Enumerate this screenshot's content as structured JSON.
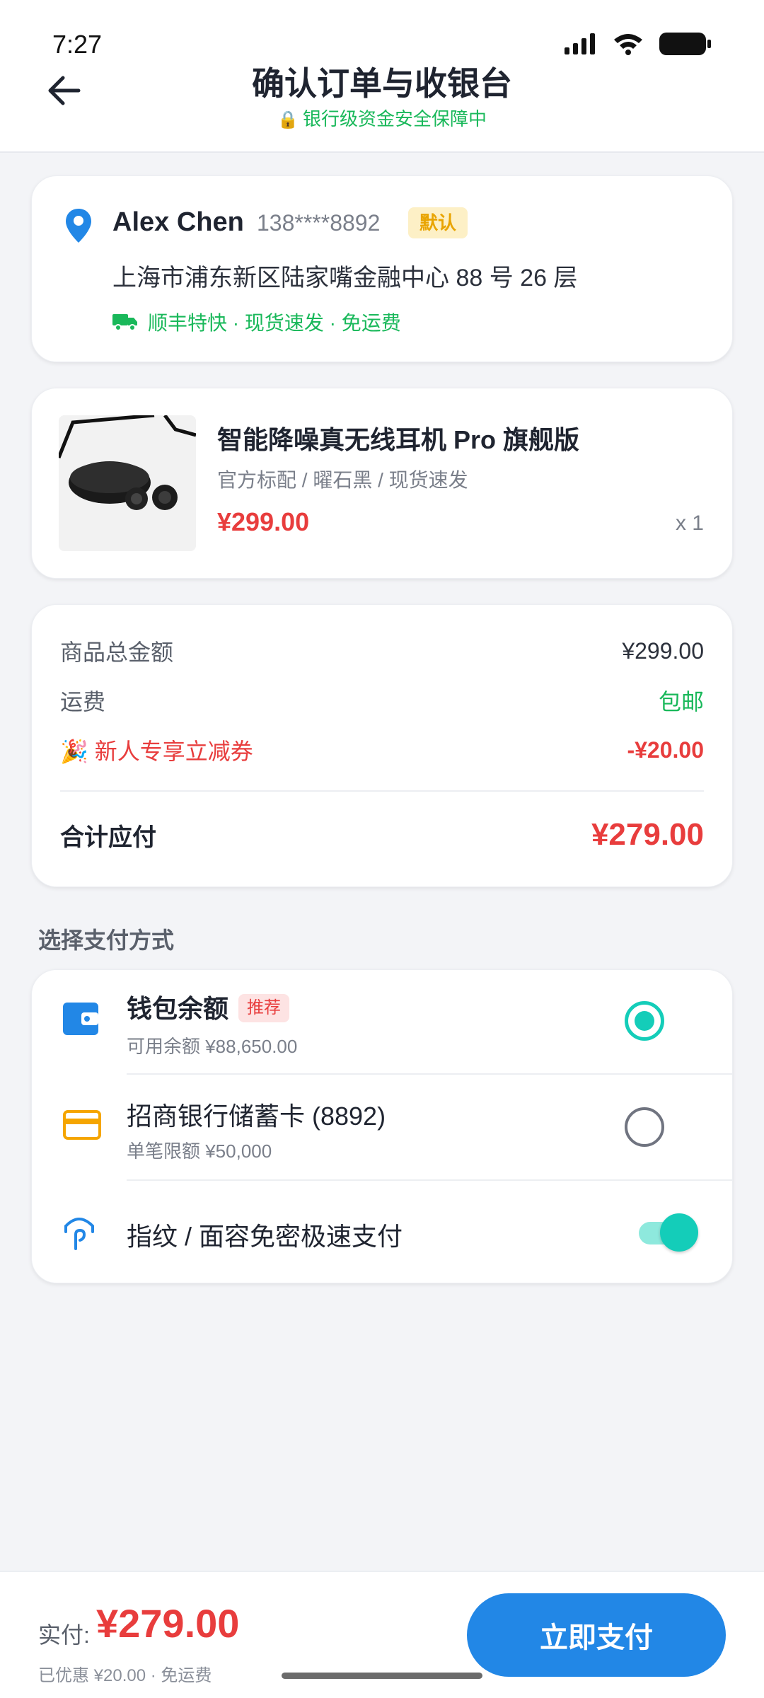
{
  "status": {
    "time": "7:27"
  },
  "header": {
    "title": "确认订单与收银台",
    "subtitle": "银行级资金安全保障中"
  },
  "address": {
    "name": "Alex Chen",
    "phone": "138****8892",
    "badge": "默认",
    "line": "上海市浦东新区陆家嘴金融中心 88 号 26 层",
    "shipping": "顺丰特快 · 现货速发 · 免运费"
  },
  "product": {
    "name": "智能降噪真无线耳机 Pro 旗舰版",
    "spec": "官方标配 / 曜石黑 / 现货速发",
    "price": "¥299.00",
    "qty": "x 1"
  },
  "summary": {
    "subtotal_label": "商品总金额",
    "subtotal_value": "¥299.00",
    "shipping_label": "运费",
    "shipping_value": "包邮",
    "coupon_label": "🎉 新人专享立减券",
    "coupon_value": "-¥20.00",
    "total_label": "合计应付",
    "total_value": "¥279.00"
  },
  "payment": {
    "section_title": "选择支付方式",
    "methods": [
      {
        "title": "钱包余额",
        "tag": "推荐",
        "sub": "可用余额 ¥88,650.00",
        "selected": true
      },
      {
        "title": "招商银行储蓄卡 (8892)",
        "sub": "单笔限额 ¥50,000",
        "selected": false
      }
    ],
    "biometric_label": "指纹 / 面容免密极速支付",
    "biometric_enabled": true
  },
  "footer": {
    "pay_label": "实付:",
    "pay_total": "¥279.00",
    "note": "已优惠 ¥20.00 · 免运费",
    "button": "立即支付"
  },
  "colors": {
    "accent": "#2287e6",
    "price": "#e83d3d",
    "success": "#19b85a",
    "teal": "#14cdb9"
  }
}
